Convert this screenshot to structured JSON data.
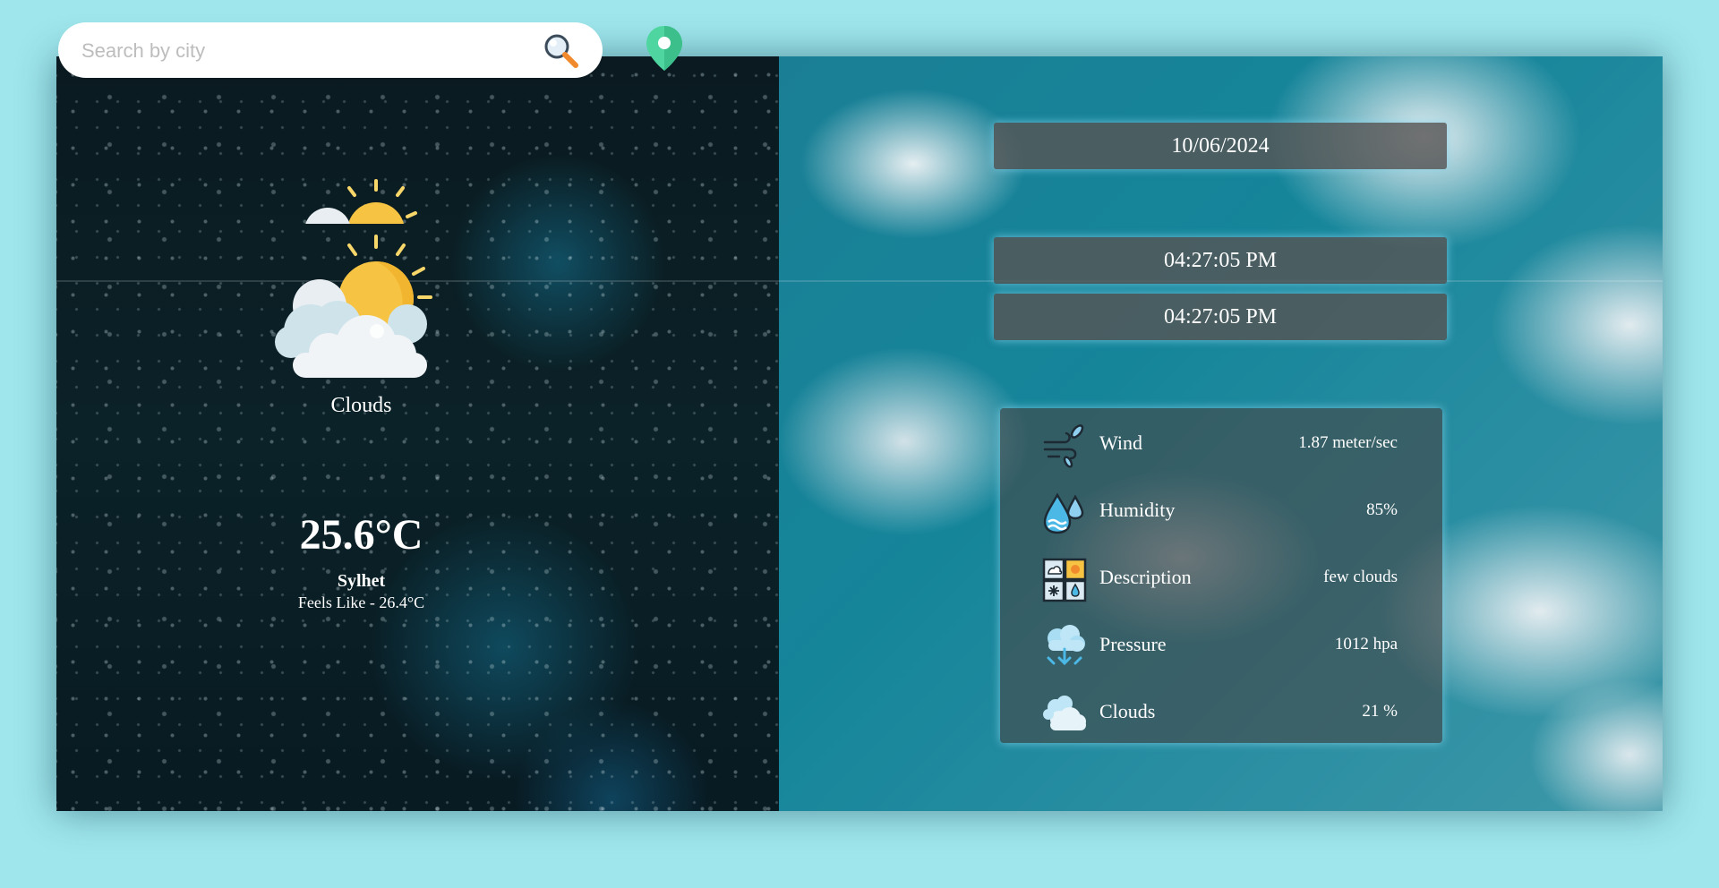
{
  "search": {
    "placeholder": "Search by city"
  },
  "weather": {
    "condition": "Clouds",
    "temperature": "25.6°C",
    "city": "Sylhet",
    "feels_like": "Feels Like - 26.4°C"
  },
  "date": "10/06/2024",
  "time_top": "04:27:05 PM",
  "time_bottom": "04:27:05 PM",
  "details": [
    {
      "label": "Wind",
      "value": "1.87 meter/sec",
      "icon": "wind-icon"
    },
    {
      "label": "Humidity",
      "value": "85%",
      "icon": "humidity-icon"
    },
    {
      "label": "Description",
      "value": "few clouds",
      "icon": "description-icon"
    },
    {
      "label": "Pressure",
      "value": "1012 hpa",
      "icon": "pressure-icon"
    },
    {
      "label": "Clouds",
      "value": "21 %",
      "icon": "clouds-icon"
    }
  ],
  "colors": {
    "page_background": "#9ee6ec",
    "pin": "#4fd6a0",
    "sun": "#f6c343"
  }
}
